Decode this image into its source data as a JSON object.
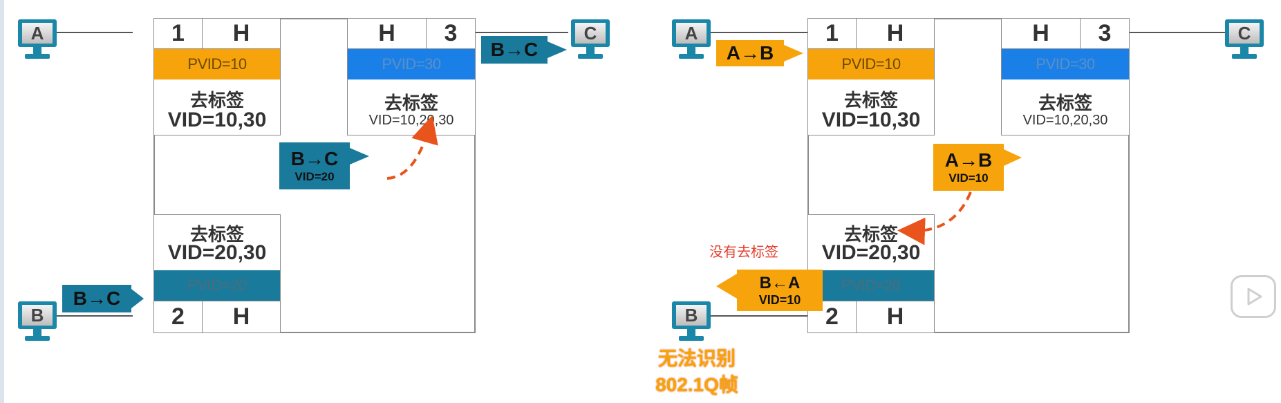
{
  "left": {
    "pc_a": "A",
    "pc_b": "B",
    "pc_c": "C",
    "port1": {
      "num": "1",
      "mode": "H",
      "pvid": "PVID=10",
      "untag": "去标签",
      "vid": "VID=10,30"
    },
    "port3": {
      "num": "3",
      "mode": "H",
      "pvid": "PVID=30",
      "untag": "去标签",
      "vid": "VID=10,20,30"
    },
    "port2": {
      "num": "2",
      "mode": "H",
      "pvid": "PVID=20",
      "untag": "去标签",
      "vid": "VID=20,30"
    },
    "frame_b_in": {
      "label": "B→C"
    },
    "frame_mid": {
      "label": "B→C",
      "vid": "VID=20"
    },
    "frame_c_out": {
      "label": "B→C"
    }
  },
  "right": {
    "pc_a": "A",
    "pc_b": "B",
    "pc_c": "C",
    "port1": {
      "num": "1",
      "mode": "H",
      "pvid": "PVID=10",
      "untag": "去标签",
      "vid": "VID=10,30"
    },
    "port3": {
      "num": "3",
      "mode": "H",
      "pvid": "PVID=30",
      "untag": "去标签",
      "vid": "VID=10,20,30"
    },
    "port2": {
      "num": "2",
      "mode": "H",
      "pvid": "PVID=20",
      "untag": "去标签",
      "vid": "VID=20,30"
    },
    "frame_a_in": {
      "label": "A→B"
    },
    "frame_mid": {
      "label": "A→B",
      "vid": "VID=10"
    },
    "frame_b_out": {
      "label": "B←A",
      "vid": "VID=10"
    },
    "note": "没有去标签",
    "warn_line1": "无法识别",
    "warn_line2": "802.1Q帧"
  },
  "colors": {
    "orange": "#f7a30b",
    "blue": "#1a80e8",
    "teal": "#1a7a9c",
    "pc": "#1a86a8",
    "arrow_dashed": "#e8541c",
    "note_red": "#e23b2a"
  }
}
